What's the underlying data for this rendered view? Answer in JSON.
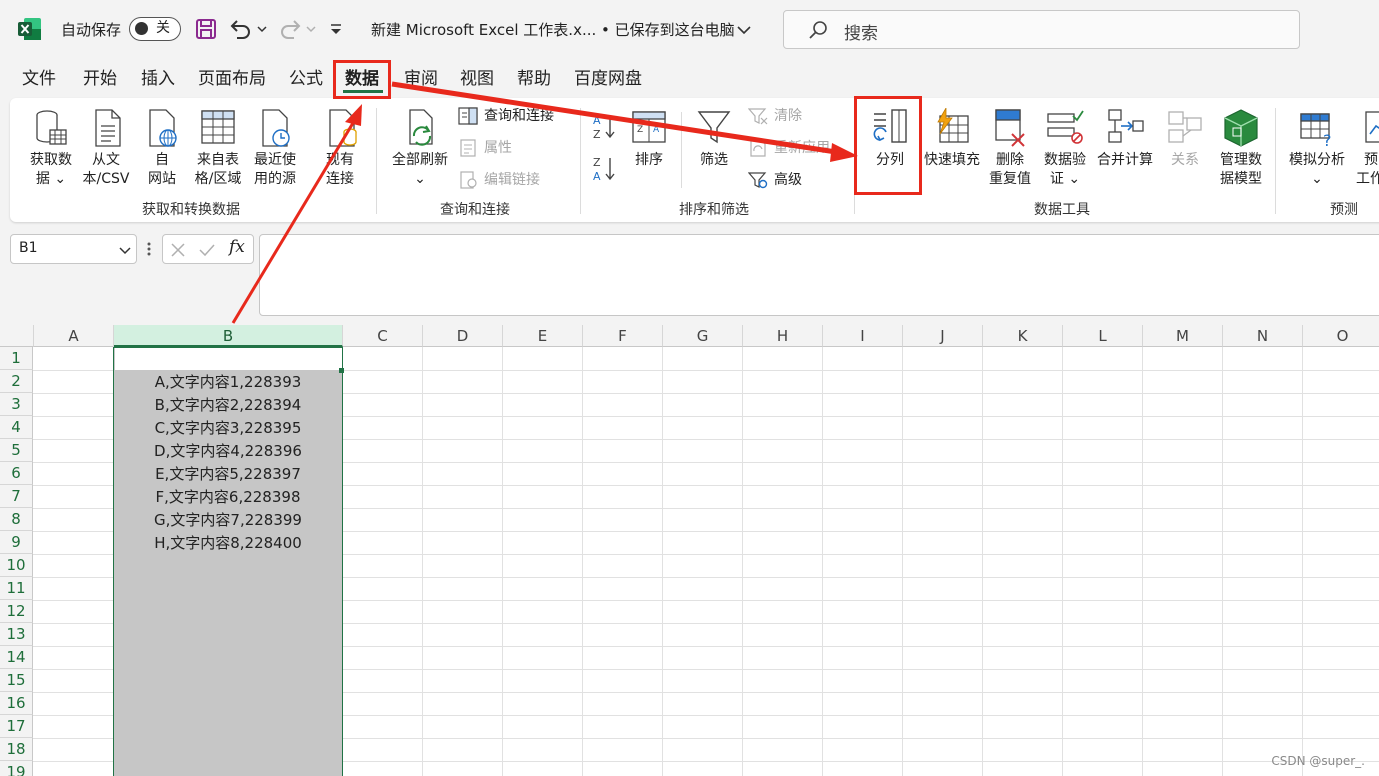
{
  "titlebar": {
    "autosave_label": "自动保存",
    "autosave_state": "关",
    "file_title": "新建 Microsoft Excel 工作表.x... • 已保存到这台电脑",
    "search_placeholder": "搜索"
  },
  "tabs": [
    "文件",
    "开始",
    "插入",
    "页面布局",
    "公式",
    "数据",
    "审阅",
    "视图",
    "帮助",
    "百度网盘"
  ],
  "active_tab": "数据",
  "ribbon": {
    "get_data": [
      "获取数",
      "据"
    ],
    "from_text": [
      "从文",
      "本/CSV"
    ],
    "from_web": [
      "自",
      "网站"
    ],
    "from_table": [
      "来自表",
      "格/区域"
    ],
    "recent_sources": [
      "最近使",
      "用的源"
    ],
    "existing_conn": [
      "现有",
      "连接"
    ],
    "group_get": "获取和转换数据",
    "refresh_all": "全部刷新",
    "queries_connections": "查询和连接",
    "properties": "属性",
    "edit_links": "编辑链接",
    "group_queries": "查询和连接",
    "sort": "排序",
    "filter": "筛选",
    "clear": "清除",
    "reapply": "重新应用",
    "advanced": "高级",
    "group_sort": "排序和筛选",
    "text_to_columns": "分列",
    "flash_fill": "快速填充",
    "remove_duplicates": [
      "删除",
      "重复值"
    ],
    "data_validation": [
      "数据验",
      "证"
    ],
    "consolidate": "合并计算",
    "relationships": "关系",
    "data_model": [
      "管理数",
      "据模型"
    ],
    "group_tools": "数据工具",
    "what_if": "模拟分析",
    "forecast_sheet": [
      "预",
      "工作"
    ],
    "group_forecast": "预测"
  },
  "formula_bar": {
    "name_box": "B1",
    "fx": "fx",
    "formula": ""
  },
  "columns": [
    "A",
    "B",
    "C",
    "D",
    "E",
    "F",
    "G",
    "H",
    "I",
    "J",
    "K",
    "L",
    "M",
    "N",
    "O"
  ],
  "rows": [
    "1",
    "2",
    "3",
    "4",
    "5",
    "6",
    "7",
    "8",
    "9",
    "10",
    "11",
    "12",
    "13",
    "14",
    "15",
    "16",
    "17",
    "18",
    "19"
  ],
  "cells_B": [
    "",
    "A,文字内容1,228393",
    "B,文字内容2,228394",
    "C,文字内容3,228395",
    "D,文字内容4,228396",
    "E,文字内容5,228397",
    "F,文字内容6,228398",
    "G,文字内容7,228399",
    "H,文字内容8,228400"
  ],
  "watermark": "CSDN @super_.",
  "colors": {
    "accent": "#217346",
    "annotation": "#e8291c",
    "selection": "#c6c6c6"
  }
}
